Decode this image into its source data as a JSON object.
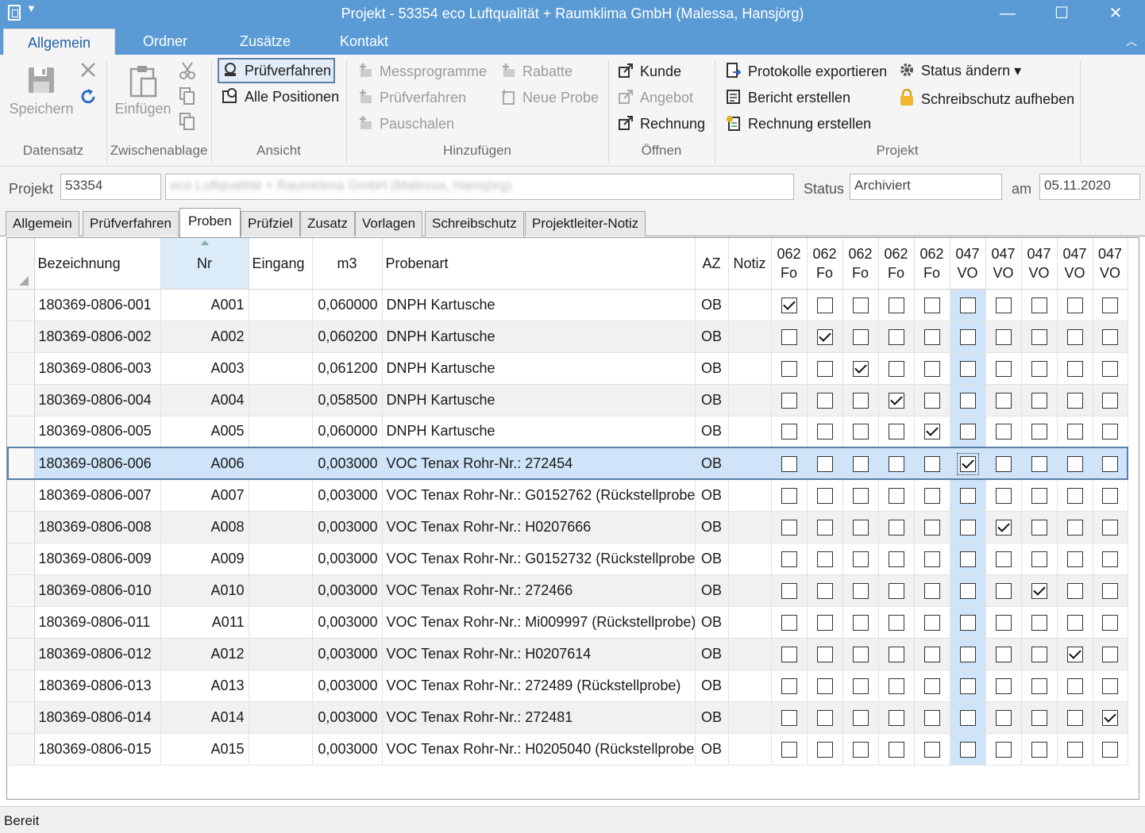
{
  "window": {
    "title": "Projekt - 53354 eco Luftqualität + Raumklima GmbH (Malessa, Hansjörg)",
    "minimize": "—",
    "maximize": "☐",
    "close": "✕",
    "qa_arrow": "▼"
  },
  "ribbon_tabs": [
    "Allgemein",
    "Ordner",
    "Zusätze",
    "Kontakt"
  ],
  "collapse": "︿",
  "ribbon": {
    "datensatz": {
      "label": "Datensatz",
      "save": "Speichern"
    },
    "zwischenablage": {
      "label": "Zwischenablage",
      "paste": "Einfügen"
    },
    "ansicht": {
      "label": "Ansicht",
      "pruefverfahren": "Prüfverfahren",
      "alle_positionen": "Alle Positionen"
    },
    "hinzufuegen": {
      "label": "Hinzufügen",
      "messprogramme": "Messprogramme",
      "pruefverfahren": "Prüfverfahren",
      "pauschalen": "Pauschalen",
      "rabatte": "Rabatte",
      "neue_probe": "Neue Probe"
    },
    "oeffnen": {
      "label": "Öffnen",
      "kunde": "Kunde",
      "angebot": "Angebot",
      "rechnung": "Rechnung"
    },
    "projekt": {
      "label": "Projekt",
      "protokolle": "Protokolle exportieren",
      "bericht": "Bericht erstellen",
      "rechnung": "Rechnung erstellen",
      "status": "Status ändern ▾",
      "schreibschutz": "Schreibschutz aufheben"
    }
  },
  "project_bar": {
    "projekt_label": "Projekt",
    "projekt_nr": "53354",
    "projekt_name": "eco Luftqualität + Raumklima GmbH (Malessa, Hansjörg)",
    "status_label": "Status",
    "status": "Archiviert",
    "am_label": "am",
    "date": "05.11.2020"
  },
  "page_tabs": [
    "Allgemein",
    "Prüfverfahren",
    "Proben",
    "Prüfziel",
    "Zusatz",
    "Vorlagen",
    "Schreibschutz",
    "Projektleiter-Notiz"
  ],
  "grid": {
    "headers": {
      "bezeichnung": "Bezeichnung",
      "nr": "Nr",
      "eingang": "Eingang",
      "m3": "m3",
      "probenart": "Probenart",
      "az": "AZ",
      "notiz": "Notiz"
    },
    "check_columns": [
      {
        "top": "062",
        "bottom": "Fo"
      },
      {
        "top": "062",
        "bottom": "Fo"
      },
      {
        "top": "062",
        "bottom": "Fo"
      },
      {
        "top": "062",
        "bottom": "Fo"
      },
      {
        "top": "062",
        "bottom": "Fo"
      },
      {
        "top": "047",
        "bottom": "VO"
      },
      {
        "top": "047",
        "bottom": "VO"
      },
      {
        "top": "047",
        "bottom": "VO"
      },
      {
        "top": "047",
        "bottom": "VO"
      },
      {
        "top": "047",
        "bottom": "VO"
      }
    ],
    "rows": [
      {
        "bez": "180369-0806-001",
        "nr": "A001",
        "eingang": "",
        "m3": "0,060000",
        "art": "DNPH Kartusche",
        "az": "OB",
        "notiz": "",
        "checked": 0
      },
      {
        "bez": "180369-0806-002",
        "nr": "A002",
        "eingang": "",
        "m3": "0,060200",
        "art": "DNPH Kartusche",
        "az": "OB",
        "notiz": "",
        "checked": 1
      },
      {
        "bez": "180369-0806-003",
        "nr": "A003",
        "eingang": "",
        "m3": "0,061200",
        "art": "DNPH Kartusche",
        "az": "OB",
        "notiz": "",
        "checked": 2
      },
      {
        "bez": "180369-0806-004",
        "nr": "A004",
        "eingang": "",
        "m3": "0,058500",
        "art": "DNPH Kartusche",
        "az": "OB",
        "notiz": "",
        "checked": 3
      },
      {
        "bez": "180369-0806-005",
        "nr": "A005",
        "eingang": "",
        "m3": "0,060000",
        "art": "DNPH Kartusche",
        "az": "OB",
        "notiz": "",
        "checked": 4
      },
      {
        "bez": "180369-0806-006",
        "nr": "A006",
        "eingang": "",
        "m3": "0,003000",
        "art": "VOC Tenax Rohr-Nr.: 272454",
        "az": "OB",
        "notiz": "",
        "checked": 5
      },
      {
        "bez": "180369-0806-007",
        "nr": "A007",
        "eingang": "",
        "m3": "0,003000",
        "art": "VOC Tenax Rohr-Nr.: G0152762 (Rückstellprobe)",
        "az": "OB",
        "notiz": "",
        "checked": -1
      },
      {
        "bez": "180369-0806-008",
        "nr": "A008",
        "eingang": "",
        "m3": "0,003000",
        "art": "VOC Tenax Rohr-Nr.: H0207666",
        "az": "OB",
        "notiz": "",
        "checked": 6
      },
      {
        "bez": "180369-0806-009",
        "nr": "A009",
        "eingang": "",
        "m3": "0,003000",
        "art": "VOC Tenax Rohr-Nr.: G0152732 (Rückstellprobe)",
        "az": "OB",
        "notiz": "",
        "checked": -1
      },
      {
        "bez": "180369-0806-010",
        "nr": "A010",
        "eingang": "",
        "m3": "0,003000",
        "art": "VOC Tenax Rohr-Nr.: 272466",
        "az": "OB",
        "notiz": "",
        "checked": 7
      },
      {
        "bez": "180369-0806-011",
        "nr": "A011",
        "eingang": "",
        "m3": "0,003000",
        "art": "VOC Tenax Rohr-Nr.: Mi009997 (Rückstellprobe)",
        "az": "OB",
        "notiz": "",
        "checked": -1
      },
      {
        "bez": "180369-0806-012",
        "nr": "A012",
        "eingang": "",
        "m3": "0,003000",
        "art": "VOC Tenax Rohr-Nr.: H0207614",
        "az": "OB",
        "notiz": "",
        "checked": 8
      },
      {
        "bez": "180369-0806-013",
        "nr": "A013",
        "eingang": "",
        "m3": "0,003000",
        "art": "VOC Tenax Rohr-Nr.: 272489 (Rückstellprobe)",
        "az": "OB",
        "notiz": "",
        "checked": -1
      },
      {
        "bez": "180369-0806-014",
        "nr": "A014",
        "eingang": "",
        "m3": "0,003000",
        "art": "VOC Tenax Rohr-Nr.: 272481",
        "az": "OB",
        "notiz": "",
        "checked": 9
      },
      {
        "bez": "180369-0806-015",
        "nr": "A015",
        "eingang": "",
        "m3": "0,003000",
        "art": "VOC Tenax Rohr-Nr.: H0205040 (Rückstellprobe)",
        "az": "OB",
        "notiz": "",
        "checked": -1
      }
    ],
    "selected_row": 5,
    "highlight_column": 5
  },
  "status_bar": "Bereit"
}
